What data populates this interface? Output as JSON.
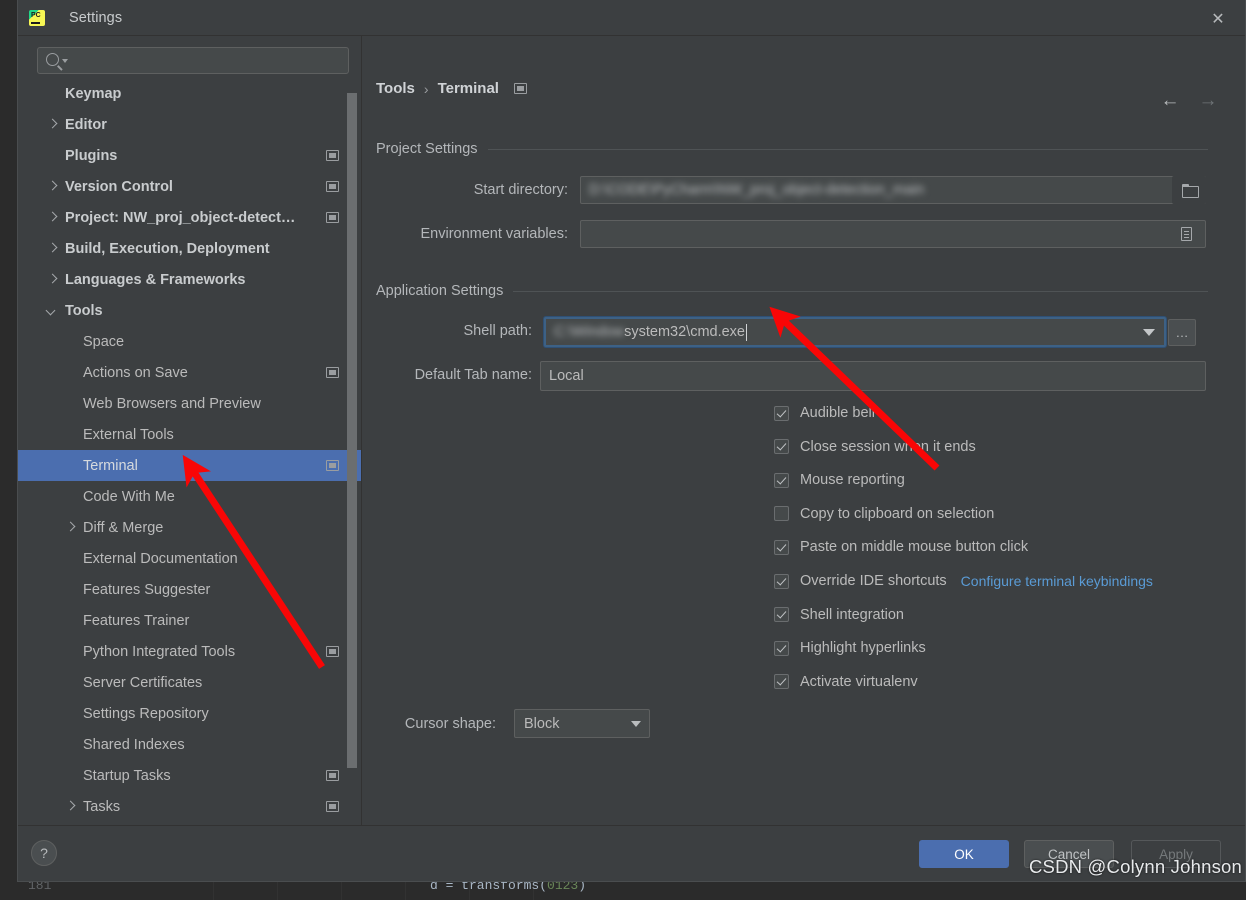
{
  "window": {
    "title": "Settings",
    "app_icon": "pycharm-icon",
    "close_label": "✕"
  },
  "search": {
    "value": "",
    "placeholder": ""
  },
  "sidebar": {
    "items": [
      {
        "label": "Keymap",
        "indent": 47,
        "bold": true,
        "arrow": "none",
        "scope_icon": false,
        "selected": false
      },
      {
        "label": "Editor",
        "indent": 47,
        "bold": true,
        "arrow": "right",
        "scope_icon": false,
        "selected": false
      },
      {
        "label": "Plugins",
        "indent": 47,
        "bold": true,
        "arrow": "none",
        "scope_icon": true,
        "selected": false
      },
      {
        "label": "Version Control",
        "indent": 47,
        "bold": true,
        "arrow": "right",
        "scope_icon": true,
        "selected": false
      },
      {
        "label": "Project: NW_proj_object-detect…",
        "indent": 47,
        "bold": true,
        "arrow": "right",
        "scope_icon": true,
        "selected": false
      },
      {
        "label": "Build, Execution, Deployment",
        "indent": 47,
        "bold": true,
        "arrow": "right",
        "scope_icon": false,
        "selected": false
      },
      {
        "label": "Languages & Frameworks",
        "indent": 47,
        "bold": true,
        "arrow": "right",
        "scope_icon": false,
        "selected": false
      },
      {
        "label": "Tools",
        "indent": 47,
        "bold": true,
        "arrow": "down",
        "scope_icon": false,
        "selected": false
      },
      {
        "label": "Space",
        "indent": 65,
        "bold": false,
        "arrow": "none",
        "scope_icon": false,
        "selected": false
      },
      {
        "label": "Actions on Save",
        "indent": 65,
        "bold": false,
        "arrow": "none",
        "scope_icon": true,
        "selected": false
      },
      {
        "label": "Web Browsers and Preview",
        "indent": 65,
        "bold": false,
        "arrow": "none",
        "scope_icon": false,
        "selected": false
      },
      {
        "label": "External Tools",
        "indent": 65,
        "bold": false,
        "arrow": "none",
        "scope_icon": false,
        "selected": false
      },
      {
        "label": "Terminal",
        "indent": 65,
        "bold": false,
        "arrow": "none",
        "scope_icon": true,
        "selected": true
      },
      {
        "label": "Code With Me",
        "indent": 65,
        "bold": false,
        "arrow": "none",
        "scope_icon": false,
        "selected": false
      },
      {
        "label": "Diff & Merge",
        "indent": 65,
        "bold": false,
        "arrow": "right",
        "scope_icon": false,
        "selected": false
      },
      {
        "label": "External Documentation",
        "indent": 65,
        "bold": false,
        "arrow": "none",
        "scope_icon": false,
        "selected": false
      },
      {
        "label": "Features Suggester",
        "indent": 65,
        "bold": false,
        "arrow": "none",
        "scope_icon": false,
        "selected": false
      },
      {
        "label": "Features Trainer",
        "indent": 65,
        "bold": false,
        "arrow": "none",
        "scope_icon": false,
        "selected": false
      },
      {
        "label": "Python Integrated Tools",
        "indent": 65,
        "bold": false,
        "arrow": "none",
        "scope_icon": true,
        "selected": false
      },
      {
        "label": "Server Certificates",
        "indent": 65,
        "bold": false,
        "arrow": "none",
        "scope_icon": false,
        "selected": false
      },
      {
        "label": "Settings Repository",
        "indent": 65,
        "bold": false,
        "arrow": "none",
        "scope_icon": false,
        "selected": false
      },
      {
        "label": "Shared Indexes",
        "indent": 65,
        "bold": false,
        "arrow": "none",
        "scope_icon": false,
        "selected": false
      },
      {
        "label": "Startup Tasks",
        "indent": 65,
        "bold": false,
        "arrow": "none",
        "scope_icon": true,
        "selected": false
      },
      {
        "label": "Tasks",
        "indent": 65,
        "bold": false,
        "arrow": "right",
        "scope_icon": true,
        "selected": false
      }
    ]
  },
  "breadcrumb": {
    "root": "Tools",
    "separator": "›",
    "leaf": "Terminal"
  },
  "nav": {
    "back": "←",
    "forward": "→"
  },
  "project_settings": {
    "section_title": "Project Settings",
    "start_directory": {
      "label": "Start directory:",
      "value": "D:\\CODE\\PyCharm\\NW_proj_object-detection_main",
      "browse_icon": "folder-icon"
    },
    "environment_variables": {
      "label": "Environment variables:",
      "value": "",
      "edit_icon": "list-icon"
    }
  },
  "application_settings": {
    "section_title": "Application Settings",
    "shell_path": {
      "label": "Shell path:",
      "value": "C:\\Windows\\system32\\cmd.exe",
      "browse_label": "…"
    },
    "default_tab_name": {
      "label": "Default Tab name:",
      "value": "Local"
    },
    "checkboxes": [
      {
        "label": "Audible bell",
        "checked": true
      },
      {
        "label": "Close session when it ends",
        "checked": true
      },
      {
        "label": "Mouse reporting",
        "checked": true
      },
      {
        "label": "Copy to clipboard on selection",
        "checked": false
      },
      {
        "label": "Paste on middle mouse button click",
        "checked": true
      },
      {
        "label": "Override IDE shortcuts",
        "checked": true,
        "link": "Configure terminal keybindings"
      },
      {
        "label": "Shell integration",
        "checked": true
      },
      {
        "label": "Highlight hyperlinks",
        "checked": true
      },
      {
        "label": "Activate virtualenv",
        "checked": true
      }
    ],
    "cursor_shape": {
      "label": "Cursor shape:",
      "value": "Block"
    }
  },
  "footer": {
    "help": "?",
    "ok": "OK",
    "cancel": "Cancel",
    "apply": "Apply"
  },
  "watermark": "CSDN @Colynn Johnson",
  "background_code": {
    "line_number": "181",
    "code_prefix": "d = transforms(",
    "code_number": "0123",
    "code_suffix": ")"
  },
  "colors": {
    "accent_blue": "#4b6eaf",
    "link_blue": "#5a9bd5",
    "panel_bg": "#3c3f41",
    "field_bg": "#45494a",
    "annotation_red": "#f90606"
  }
}
